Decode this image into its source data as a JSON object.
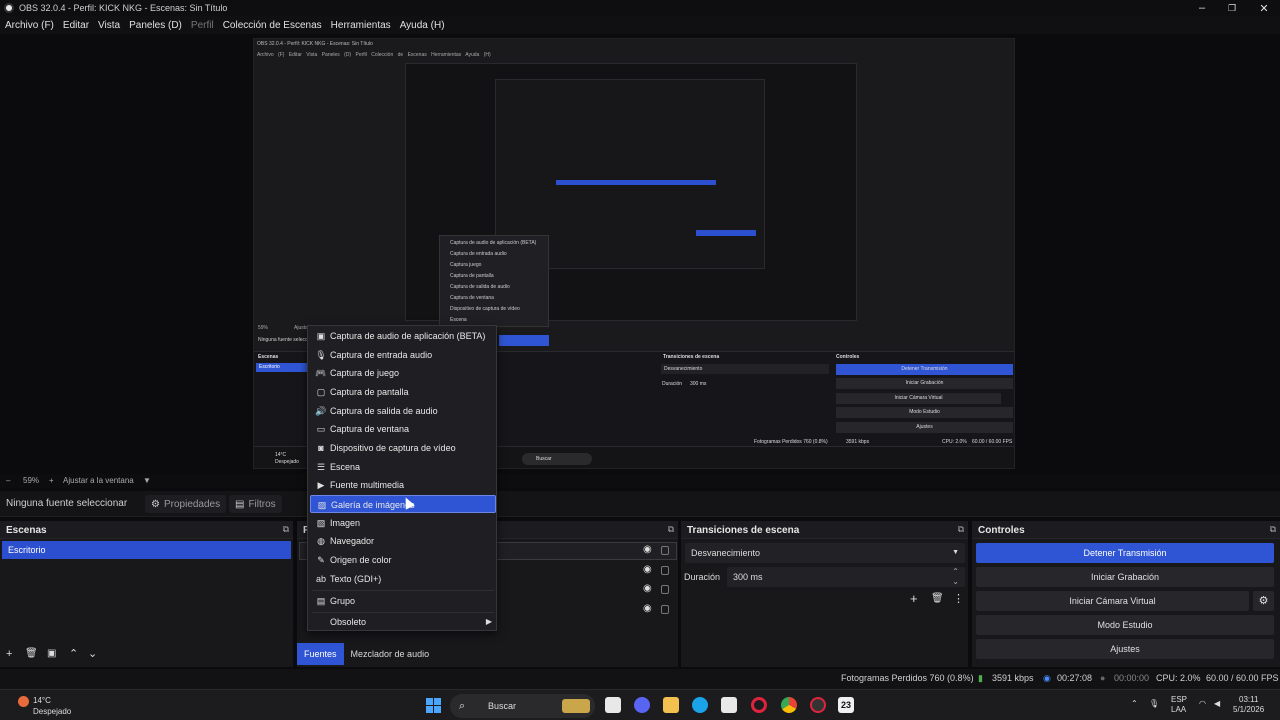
{
  "window": {
    "title": "OBS 32.0.4 - Perfil: KICK NKG - Escenas: Sin Título",
    "minimize": "–",
    "maximize": "❐",
    "close": "✕"
  },
  "menu": [
    "Archivo (F)",
    "Editar",
    "Vista",
    "Paneles (D)",
    "Perfil",
    "Colección de Escenas",
    "Herramientas",
    "Ayuda (H)"
  ],
  "zoom": {
    "minus": "–",
    "value": "59%",
    "plus": "+",
    "fit": "Ajustar a la ventana",
    "caret": "▼"
  },
  "source_toolbar": {
    "no_source": "Ninguna fuente seleccionar",
    "properties": "Propiedades",
    "filters": "Filtros"
  },
  "docks": {
    "scenes": {
      "title": "Escenas",
      "items": [
        "Escritorio"
      ]
    },
    "sources": {
      "title": "F"
    },
    "transitions": {
      "title": "Transiciones de escena",
      "selected": "Desvanecimiento",
      "duration_label": "Duración",
      "duration_value": "300 ms"
    },
    "controls": {
      "title": "Controles",
      "buttons": [
        "Detener Transmisión",
        "Iniciar Grabación",
        "Iniciar Cámara Virtual",
        "Modo Estudio",
        "Ajustes"
      ]
    }
  },
  "tabs": [
    "Fuentes",
    "Mezclador de audio"
  ],
  "context_menu": {
    "items": [
      {
        "label": "Captura de audio de aplicación (BETA)",
        "icon": "app-audio-icon"
      },
      {
        "label": "Captura de entrada audio",
        "icon": "mic-icon"
      },
      {
        "label": "Captura de juego",
        "icon": "gamepad-icon"
      },
      {
        "label": "Captura de pantalla",
        "icon": "monitor-icon"
      },
      {
        "label": "Captura de salida de audio",
        "icon": "speaker-icon"
      },
      {
        "label": "Captura de ventana",
        "icon": "window-icon"
      },
      {
        "label": "Dispositivo de captura de vídeo",
        "icon": "camera-icon"
      },
      {
        "label": "Escena",
        "icon": "list-icon"
      },
      {
        "label": "Fuente multimedia",
        "icon": "play-icon"
      },
      {
        "label": "Galería de imágenes",
        "icon": "gallery-icon"
      },
      {
        "label": "Imagen",
        "icon": "image-icon"
      },
      {
        "label": "Navegador",
        "icon": "globe-icon"
      },
      {
        "label": "Origen de color",
        "icon": "brush-icon"
      },
      {
        "label": "Texto (GDI+)",
        "icon": "text-icon"
      },
      {
        "label": "Grupo",
        "icon": "folder-icon"
      },
      {
        "label": "Obsoleto",
        "icon": ""
      }
    ],
    "highlighted_index": 9
  },
  "status": {
    "dropped": "Fotogramas Perdidos 760 (0.8%)",
    "kbps": "3591 kbps",
    "stream_time": "00:27:08",
    "rec_time": "00:00:00",
    "cpu": "CPU: 2.0%",
    "fps": "60.00 / 60.00 FPS"
  },
  "taskbar": {
    "temp": "14°C",
    "condition": "Despejado",
    "search": "Buscar",
    "lang": "ESP",
    "lang2": "LAA",
    "time": "03:11",
    "date": "5/1/2026",
    "badge": "23"
  },
  "preview": {
    "title": "OBS 32.0.4 - Perfil: KICK NKG - Escenas: Sin Título",
    "menu": "Archivo (F) Editar Vista Paneles (D) Perfil Colección de Escenas Herramientas Ayuda (H)",
    "mini_menu": [
      "Captura de audio de aplicación (BETA)",
      "Captura de entrada audio",
      "Captura juego",
      "Captura de pantalla",
      "Captura de salida de audio",
      "Captura de ventana",
      "Dispositivo de captura de vídeo",
      "Escena"
    ],
    "zoom": "59%",
    "fit": "Ajustar a la ventana",
    "no_source": "Ninguna fuente seleccionar",
    "scenes": "Escenas",
    "scene_item": "Escritorio",
    "transitions": "Transiciones de escena",
    "transition": "Desvanecimiento",
    "duration": "Duración",
    "duration_value": "300 ms",
    "controls": "Controles",
    "ctrl_buttons": [
      "Detener Transmisión",
      "Iniciar Grabación",
      "Iniciar Cámara Virtual",
      "Modo Estudio",
      "Ajustes"
    ],
    "status": "Fotogramas Perdidos 760 (0.8%)",
    "kbps": "3591 kbps",
    "cpu": "CPU: 2.0%",
    "fps": "60.00 / 60.00 FPS",
    "search": "Buscar",
    "temp": "14°C",
    "cond": "Despejado"
  },
  "colors": {
    "accent": "#2f55d4",
    "panel": "#18181b",
    "background": "#0b0b0d"
  }
}
